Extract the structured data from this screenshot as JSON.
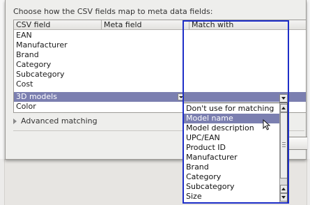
{
  "dialog": {
    "instruction": "Choose how the CSV fields map to meta data fields:",
    "advanced_label": "Advanced matching"
  },
  "table": {
    "columns": [
      "CSV field",
      "Meta field",
      "Match with"
    ],
    "rows": [
      "EAN",
      "Manufacturer",
      "Brand",
      "Category",
      "Subcategory",
      "Cost",
      "3D models",
      "Color"
    ],
    "selected_row": "3D models"
  },
  "dropdown": {
    "options": [
      "Don't use for matching",
      "Model name",
      "Model description",
      "UPC/EAN",
      "Product ID",
      "Manufacturer",
      "Brand",
      "Category",
      "Subcategory",
      "Size"
    ],
    "highlighted": "Model name"
  },
  "icons": {
    "expander": "triangle-right-icon",
    "pointer": "mouse-pointer-icon"
  },
  "colors": {
    "selection": "#7b7fb0",
    "highlight_border": "#1e2ec8"
  }
}
